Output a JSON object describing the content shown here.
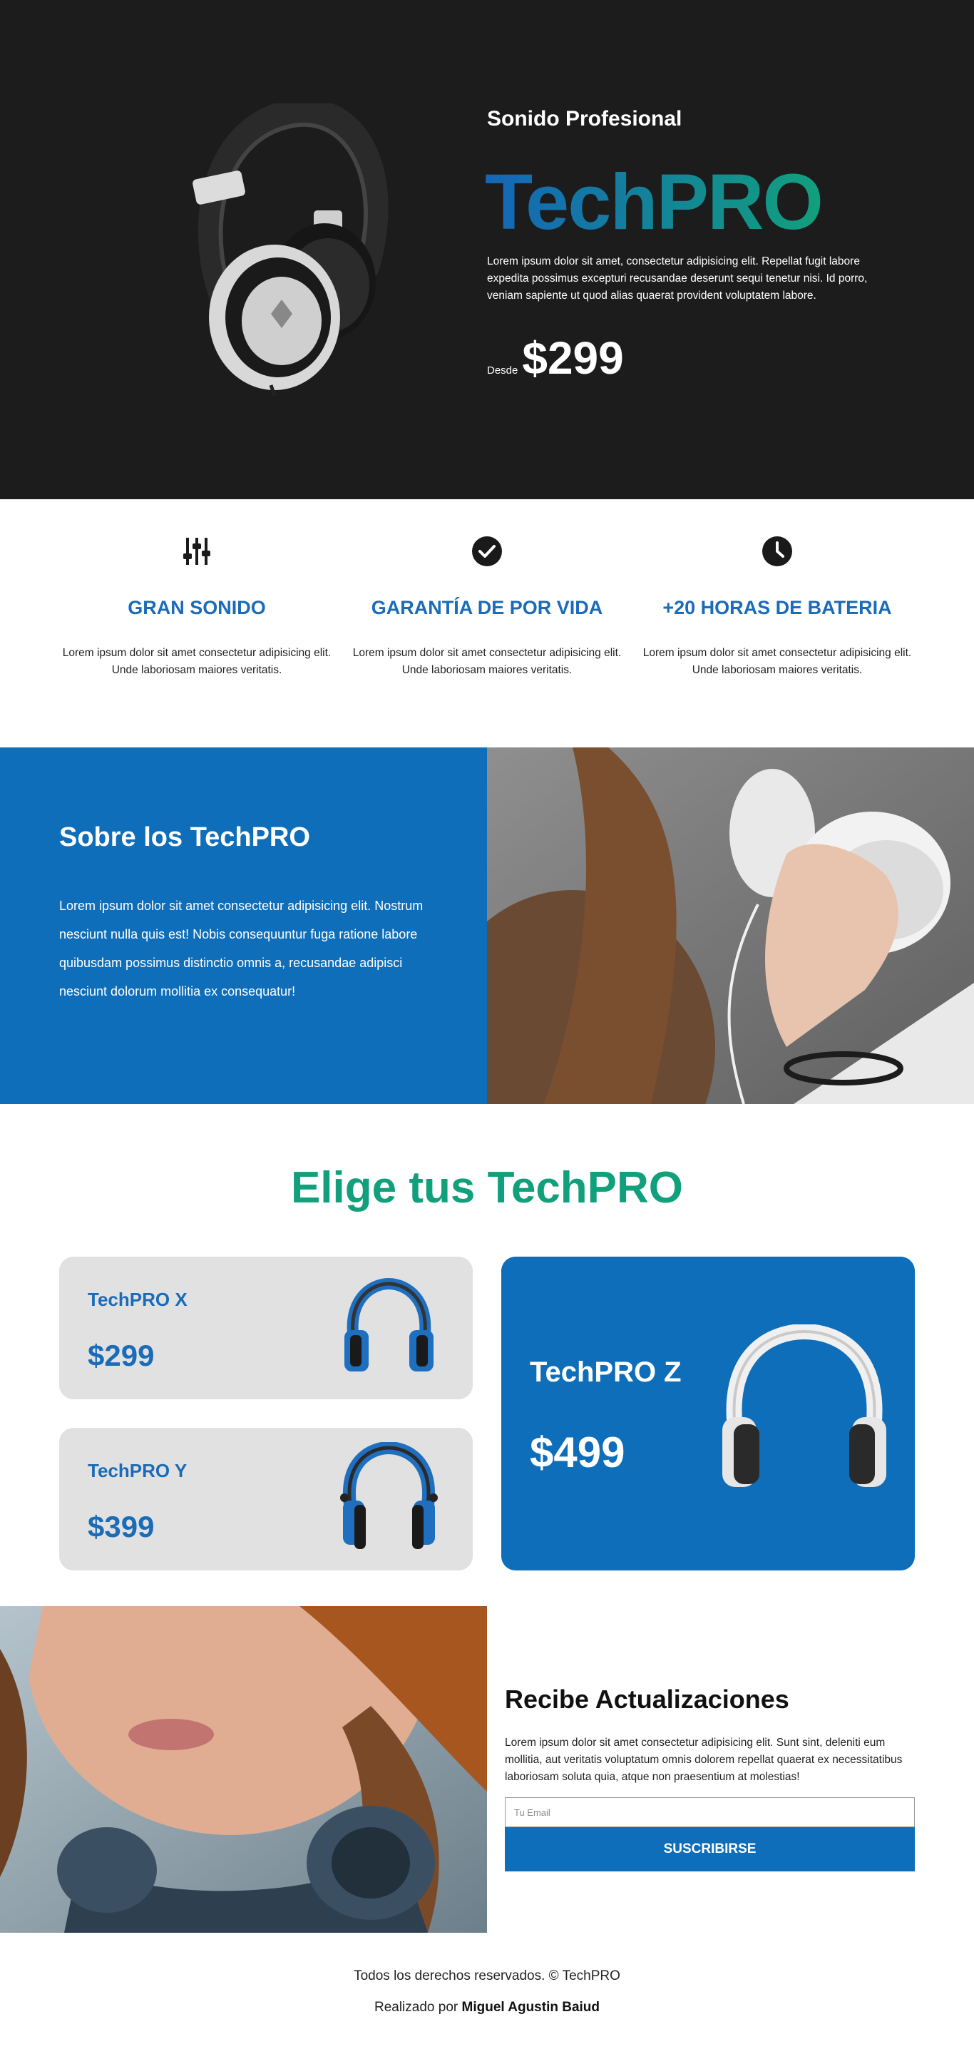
{
  "hero": {
    "subtitle": "Sonido Profesional",
    "brand": "TechPRO",
    "description": "Lorem ipsum dolor sit amet, consectetur adipisicing elit. Repellat fugit labore expedita possimus excepturi recusandae deserunt sequi tenetur nisi. Id porro, veniam sapiente ut quod alias quaerat provident voluptatem labore.",
    "price_prefix": "Desde",
    "price": "$299"
  },
  "features": [
    {
      "icon": "sliders-icon",
      "title": "GRAN SONIDO",
      "text": "Lorem ipsum dolor sit amet consectetur adipisicing elit. Unde laboriosam maiores veritatis."
    },
    {
      "icon": "badge-check-icon",
      "title": "GARANTÍA DE POR VIDA",
      "text": "Lorem ipsum dolor sit amet consectetur adipisicing elit. Unde laboriosam maiores veritatis."
    },
    {
      "icon": "clock-icon",
      "title": "+20 HORAS DE BATERIA",
      "text": "Lorem ipsum dolor sit amet consectetur adipisicing elit. Unde laboriosam maiores veritatis."
    }
  ],
  "about": {
    "title": "Sobre los TechPRO",
    "text": "Lorem ipsum dolor sit amet consectetur adipisicing elit. Nostrum nesciunt nulla quis est! Nobis consequuntur fuga ratione labore quibusdam possimus distinctio omnis a, recusandae adipisci nesciunt dolorum mollitia ex consequatur!"
  },
  "products": {
    "title": "Elige tus TechPRO",
    "items": [
      {
        "name": "TechPRO X",
        "price": "$299"
      },
      {
        "name": "TechPRO Y",
        "price": "$399"
      },
      {
        "name": "TechPRO Z",
        "price": "$499"
      }
    ]
  },
  "newsletter": {
    "title": "Recibe Actualizaciones",
    "text": "Lorem ipsum dolor sit amet consectetur adipisicing elit. Sunt sint, deleniti eum mollitia, aut veritatis voluptatum omnis dolorem repellat quaerat ex necessitatibus laboriosam soluta quia, atque non praesentium at molestias!",
    "email_placeholder": "Tu Email",
    "button_label": "SUSCRIBIRSE"
  },
  "footer": {
    "rights": "Todos los derechos reservados. © TechPRO",
    "made_by_prefix": "Realizado por",
    "author": "Miguel Agustin Baiud"
  },
  "colors": {
    "hero_bg": "#1c1c1c",
    "primary_blue": "#0e6eb9",
    "brand_green": "#12a07c",
    "card_gray": "#e1e1e1"
  }
}
